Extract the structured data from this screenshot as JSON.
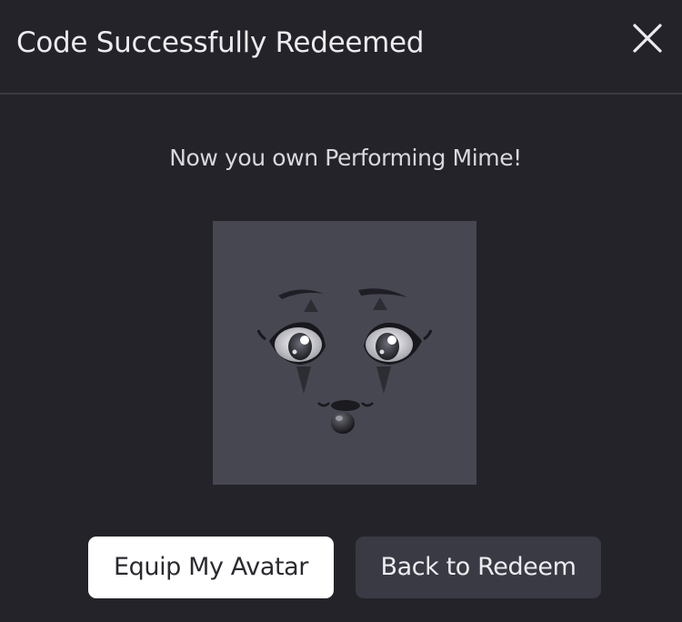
{
  "modal": {
    "title": "Code Successfully Redeemed",
    "close_icon": "close-icon",
    "message": "Now you own Performing Mime!",
    "item_image": "performing-mime-face",
    "buttons": {
      "equip_label": "Equip My Avatar",
      "back_label": "Back to Redeem"
    }
  },
  "colors": {
    "background": "#232329",
    "divider": "#3a3a44",
    "thumbnail_bg": "#474752",
    "primary_button_bg": "#ffffff",
    "secondary_button_bg": "#3a3a44"
  }
}
